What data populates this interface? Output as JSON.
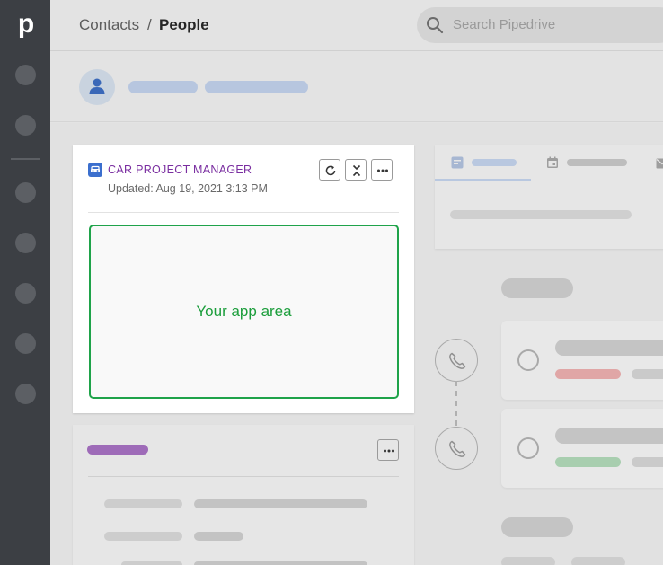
{
  "nav": {
    "logo": "p",
    "items": [
      "nav-item-1",
      "nav-item-2",
      "nav-item-3",
      "nav-item-4",
      "nav-item-5",
      "nav-item-6",
      "nav-item-7"
    ]
  },
  "breadcrumb": {
    "parent": "Contacts",
    "separator": "/",
    "current": "People"
  },
  "search": {
    "placeholder": "Search Pipedrive"
  },
  "app_panel": {
    "title": "CAR PROJECT MANAGER",
    "updated": "Updated: Aug 19, 2021 3:13 PM",
    "app_area_label": "Your app area",
    "buttons": [
      "refresh-icon",
      "collapse-icon",
      "more-icon"
    ]
  },
  "colors": {
    "accent_purple": "#7a2ea0",
    "app_area_green": "#1fa34a",
    "nav_bg": "#3c3f44",
    "icon_blue": "#3b6fce"
  }
}
